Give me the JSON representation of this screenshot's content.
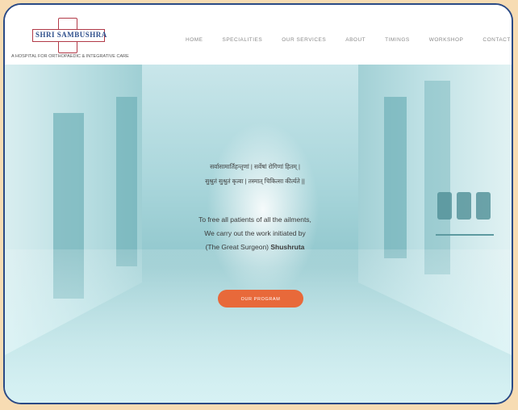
{
  "logo": {
    "text": "SHRI SAMBUSHRA",
    "tagline": "A HOSPITAL FOR ORTHOPAEDIC & INTEGRATIVE CARE"
  },
  "nav": {
    "items": [
      "HOME",
      "SPECIALITIES",
      "OUR SERVICES",
      "ABOUT",
      "TIMINGS",
      "WORKSHOP",
      "CONTACT"
    ]
  },
  "hero": {
    "sanskrit_line1": "सर्वासामार्तिहन्तृणां | सर्वेषां रोगिणां हितम् |",
    "sanskrit_line2": "सुश्रुतं सुश्रुतं कृत्वा | तस्मात् चिकित्सा कीर्त्यते ||",
    "english_line1": "To free all patients of all the ailments,",
    "english_line2": "We carry out the work initiated by",
    "english_line3_prefix": "(The Great Surgeon) ",
    "english_line3_bold": "Shushruta",
    "cta_label": "OUR PROGRAM"
  },
  "colors": {
    "accent": "#e8693a",
    "frame": "#2a4a86",
    "background": "#f7dcb3"
  }
}
